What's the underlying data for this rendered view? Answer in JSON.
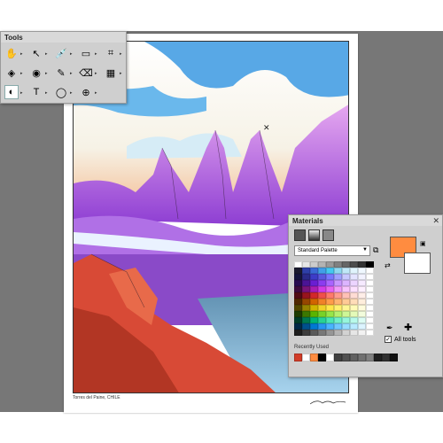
{
  "tools_palette": {
    "title": "Tools",
    "items": [
      {
        "name": "pan-tool",
        "icon": "hand-icon",
        "glyph": "✋"
      },
      {
        "name": "pick-tool",
        "icon": "arrow-select-icon",
        "glyph": "↖"
      },
      {
        "name": "dropper-tool",
        "icon": "dropper-icon",
        "glyph": "💉"
      },
      {
        "name": "selection-tool",
        "icon": "rect-select-icon",
        "glyph": "▭"
      },
      {
        "name": "crop-tool",
        "icon": "crop-icon",
        "glyph": "⌗"
      },
      {
        "name": "object-tool",
        "icon": "layers-icon",
        "glyph": "◈"
      },
      {
        "name": "red-eye-tool",
        "icon": "eye-icon",
        "glyph": "◉"
      },
      {
        "name": "paint-brush-tool",
        "icon": "brush-icon",
        "glyph": "✎"
      },
      {
        "name": "eraser-tool",
        "icon": "eraser-icon",
        "glyph": "⌫"
      },
      {
        "name": "flood-fill-tool",
        "icon": "bucket-icon",
        "glyph": "▦"
      },
      {
        "name": "color-changer-tool",
        "icon": "color-changer-icon",
        "glyph": "◐"
      },
      {
        "name": "text-tool",
        "icon": "text-icon",
        "glyph": "T"
      },
      {
        "name": "preset-shape-tool",
        "icon": "ellipse-icon",
        "glyph": "◯"
      },
      {
        "name": "pen-tool",
        "icon": "crosshair-icon",
        "glyph": "⊕"
      }
    ]
  },
  "canvas": {
    "caption": "Torres del Paine, CHILE"
  },
  "materials_palette": {
    "title": "Materials",
    "palette_select": "Standard Palette",
    "recently_used_label": "Recently Used",
    "all_tools_label": "All tools",
    "all_tools_checked": true,
    "foreground_color": "#ff8c40",
    "background_color": "#ffffff",
    "swatches": [
      "#ffffff",
      "#e6e6e6",
      "#cccccc",
      "#b3b3b3",
      "#999999",
      "#808080",
      "#666666",
      "#4d4d4d",
      "#333333",
      "#000000",
      "#1a1a2e",
      "#2e3fa8",
      "#3a6ad6",
      "#41a0e8",
      "#45c8f0",
      "#8ed8f0",
      "#c0e8f8",
      "#e0f4fc",
      "#f0f8ff",
      "#ffffff",
      "#14143c",
      "#2a2a8a",
      "#3c3cc8",
      "#5a5ae0",
      "#7878ff",
      "#a0a0ff",
      "#c8c8ff",
      "#e4e4ff",
      "#f2f2ff",
      "#ffffff",
      "#280a50",
      "#4a1496",
      "#6a1ed2",
      "#8c3cf0",
      "#aa64ff",
      "#c896ff",
      "#dcb4ff",
      "#ecd4ff",
      "#f6eaff",
      "#ffffff",
      "#3c0a3c",
      "#78147a",
      "#aa1eb4",
      "#d23ce6",
      "#e664f0",
      "#f09af8",
      "#f8c4fc",
      "#fce0fe",
      "#fef0ff",
      "#ffffff",
      "#500a14",
      "#96141e",
      "#d2282a",
      "#f0504a",
      "#ff7a6a",
      "#ff9c8e",
      "#ffc0b6",
      "#ffdcd4",
      "#ffeee8",
      "#ffffff",
      "#502800",
      "#964600",
      "#d26400",
      "#f08228",
      "#ff9c4a",
      "#ffb470",
      "#ffca96",
      "#ffdcb8",
      "#ffeedc",
      "#ffffff",
      "#504600",
      "#968200",
      "#d2b400",
      "#f0d228",
      "#ffe64a",
      "#fff070",
      "#fff696",
      "#fffab8",
      "#fffcdc",
      "#ffffff",
      "#1e3c00",
      "#3c7800",
      "#5ab400",
      "#78d228",
      "#96e64a",
      "#b4f070",
      "#cef696",
      "#e4fab8",
      "#f2fcdc",
      "#ffffff",
      "#003c28",
      "#007850",
      "#00b478",
      "#28d296",
      "#4ae6b4",
      "#70f0c8",
      "#96f6dc",
      "#b8faea",
      "#dcfcf4",
      "#ffffff",
      "#002846",
      "#00508c",
      "#0078d2",
      "#2896f0",
      "#4ab4ff",
      "#70c8ff",
      "#96dcff",
      "#b8eaff",
      "#dcf4ff",
      "#ffffff",
      "#1e1e1e",
      "#3c3c3c",
      "#5a5a5a",
      "#787878",
      "#969696",
      "#b4b4b4",
      "#d2d2d2",
      "#e6e6e6",
      "#f2f2f2",
      "#ffffff"
    ],
    "recent_colors": [
      "#d23c28",
      "#ffffff",
      "#ff8c40",
      "#000000",
      "#ffffff",
      "#404040",
      "#505050",
      "#606060",
      "#707070",
      "#808080",
      "#202020",
      "#303030",
      "#101010"
    ]
  }
}
